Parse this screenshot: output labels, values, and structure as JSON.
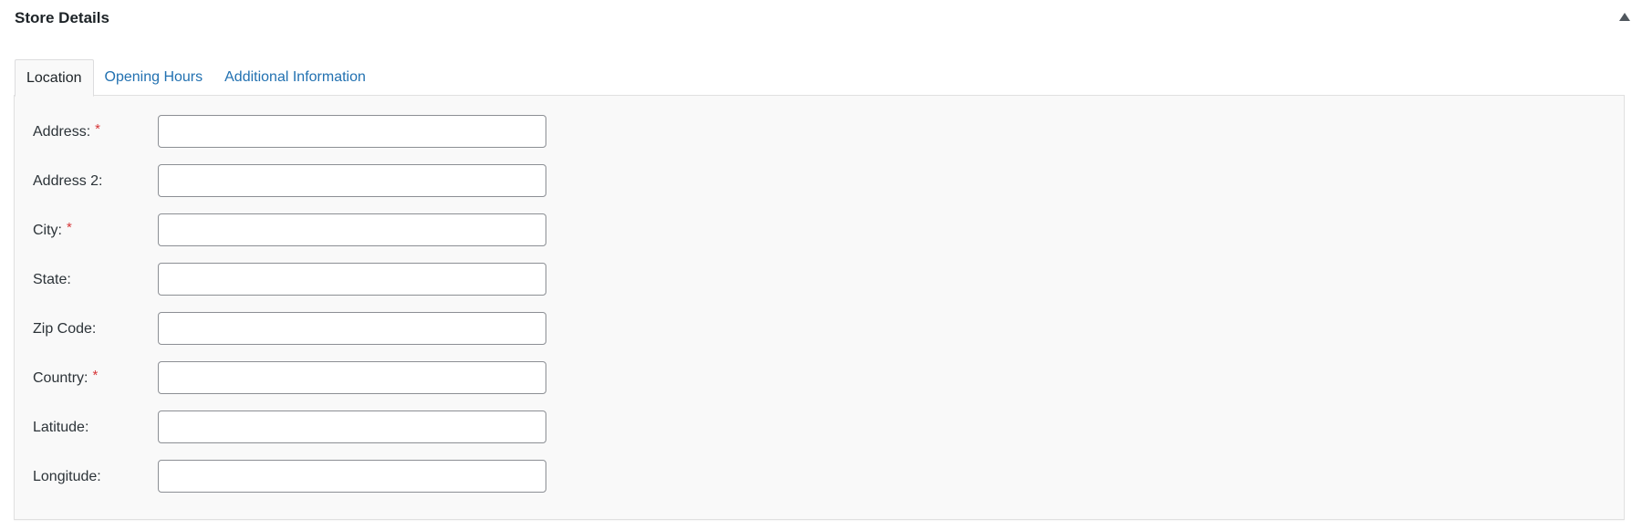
{
  "header": {
    "title": "Store Details",
    "toggle_icon": "triangle-up-icon"
  },
  "tabs": [
    {
      "label": "Location",
      "active": true
    },
    {
      "label": "Opening Hours",
      "active": false
    },
    {
      "label": "Additional Information",
      "active": false
    }
  ],
  "form": {
    "required_marker": "*",
    "fields": [
      {
        "label": "Address:",
        "required": true,
        "value": "",
        "placeholder": ""
      },
      {
        "label": "Address 2:",
        "required": false,
        "value": "",
        "placeholder": ""
      },
      {
        "label": "City:",
        "required": true,
        "value": "",
        "placeholder": ""
      },
      {
        "label": "State:",
        "required": false,
        "value": "",
        "placeholder": ""
      },
      {
        "label": "Zip Code:",
        "required": false,
        "value": "",
        "placeholder": ""
      },
      {
        "label": "Country:",
        "required": true,
        "value": "",
        "placeholder": ""
      },
      {
        "label": "Latitude:",
        "required": false,
        "value": "",
        "placeholder": ""
      },
      {
        "label": "Longitude:",
        "required": false,
        "value": "",
        "placeholder": ""
      }
    ]
  },
  "colors": {
    "link": "#2271b1",
    "required": "#d63638",
    "text": "#1d2327"
  }
}
